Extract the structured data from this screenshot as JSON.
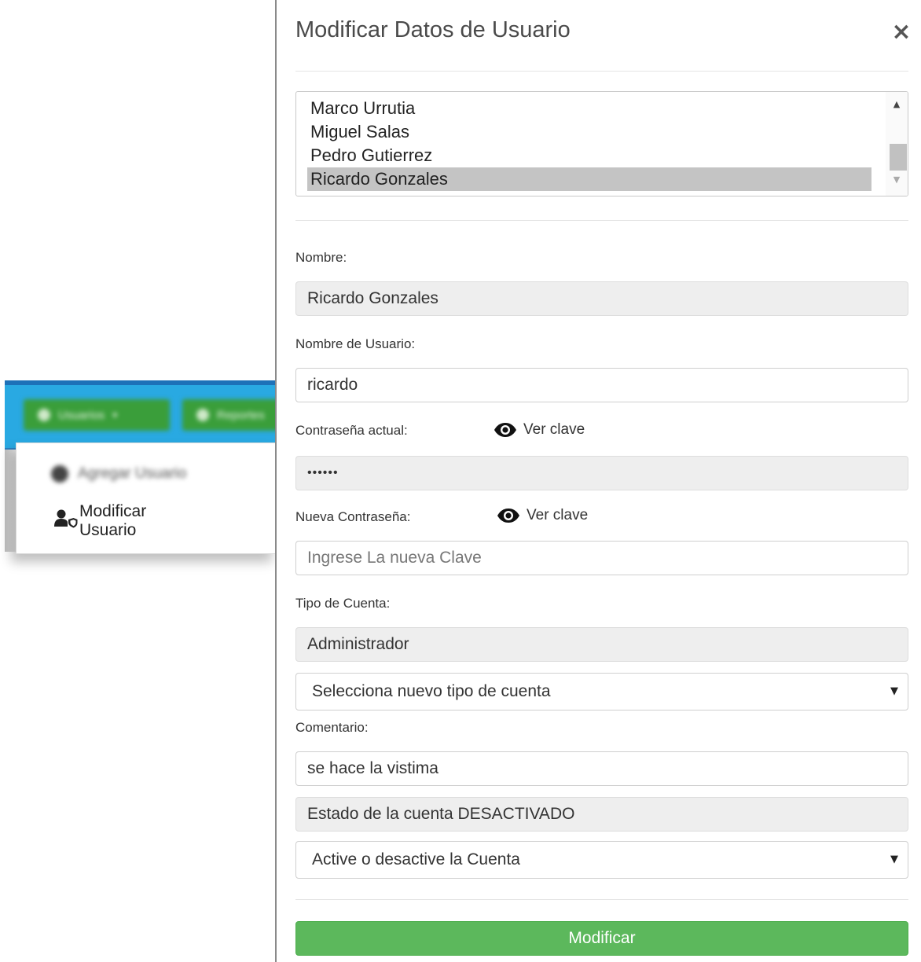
{
  "background": {
    "navbar": {
      "usuarios_label": "Usuarios",
      "reportes_label": "Reportes"
    },
    "dropdown": {
      "agregar_label": "Agregar Usuario",
      "modificar_label": "Modificar Usuario"
    }
  },
  "modal": {
    "title": "Modificar Datos de Usuario",
    "close_symbol": "×",
    "user_list": {
      "items": [
        "Marco Urrutia",
        "Miguel Salas",
        "Pedro Gutierrez",
        "Ricardo Gonzales"
      ],
      "selected": "Ricardo Gonzales"
    },
    "nombre": {
      "label": "Nombre:",
      "value": "Ricardo Gonzales"
    },
    "nombre_usuario": {
      "label": "Nombre de Usuario:",
      "value": "ricardo"
    },
    "contrasena_actual": {
      "label": "Contraseña actual:",
      "toggle_label": "Ver clave",
      "value": "••••••"
    },
    "nueva_contrasena": {
      "label": "Nueva Contraseña:",
      "toggle_label": "Ver clave",
      "placeholder": "Ingrese La nueva Clave"
    },
    "tipo_cuenta": {
      "label": "Tipo de Cuenta:",
      "current_value": "Administrador",
      "select_text": "Selecciona nuevo tipo de cuenta"
    },
    "comentario": {
      "label": "Comentario:",
      "value": "se hace la vistima"
    },
    "estado": {
      "status_text": "Estado de la cuenta DESACTIVADO",
      "select_text": "Active o desactive la Cuenta"
    },
    "submit_label": "Modificar"
  },
  "colors": {
    "navbar": "#29a9e2",
    "nav_button": "#3a9e3a",
    "submit_button": "#5cb85c",
    "readonly_field": "#eeeeee",
    "selected_item": "#c4c4c4"
  },
  "icons": {
    "close": "close-icon",
    "eye": "eye-icon",
    "user_edit": "user-shield-icon",
    "caret": "caret-down-icon"
  }
}
